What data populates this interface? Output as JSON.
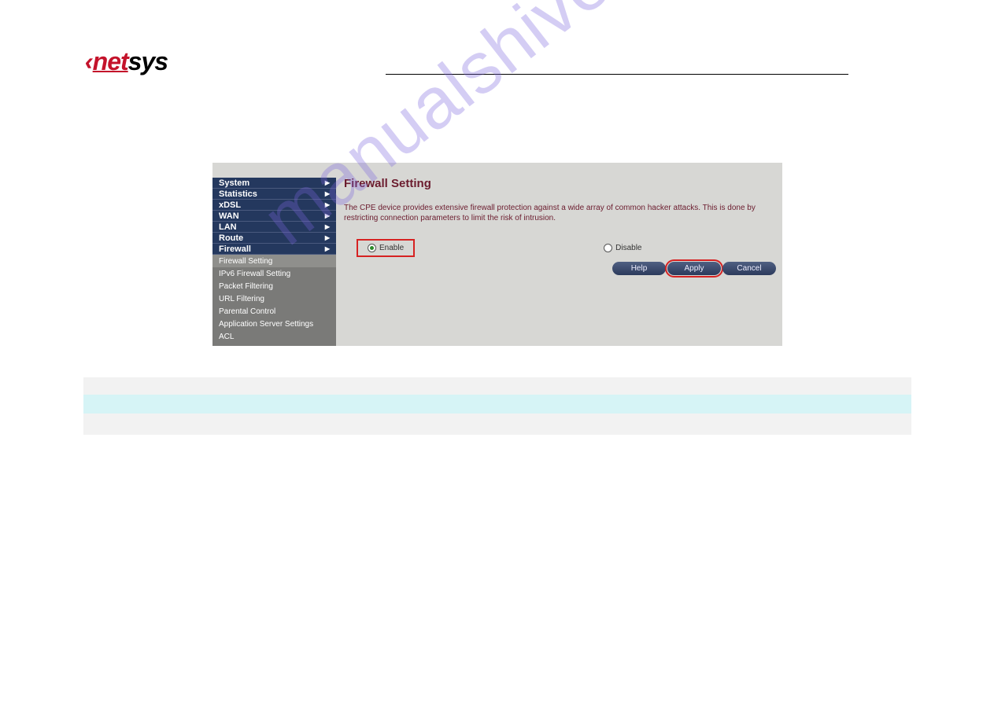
{
  "logo": {
    "prefix": "‹",
    "part1": "net",
    "part2": "sys"
  },
  "watermark": "manualshive.com",
  "nav": {
    "main": [
      {
        "label": "System"
      },
      {
        "label": "Statistics"
      },
      {
        "label": "xDSL"
      },
      {
        "label": "WAN"
      },
      {
        "label": "LAN"
      },
      {
        "label": "Route"
      },
      {
        "label": "Firewall"
      }
    ],
    "sub": [
      {
        "label": "Firewall Setting",
        "active": true
      },
      {
        "label": "IPv6 Firewall Setting",
        "active": false
      },
      {
        "label": "Packet Filtering",
        "active": false
      },
      {
        "label": "URL Filtering",
        "active": false
      },
      {
        "label": "Parental Control",
        "active": false
      },
      {
        "label": "Application Server Settings",
        "active": false
      },
      {
        "label": "ACL",
        "active": false
      }
    ]
  },
  "panel": {
    "title": "Firewall Setting",
    "description": "The CPE device provides extensive firewall protection against a wide array of common hacker attacks. This is done by restricting connection parameters to limit the risk of intrusion.",
    "options": {
      "enable": "Enable",
      "disable": "Disable"
    },
    "buttons": {
      "help": "Help",
      "apply": "Apply",
      "cancel": "Cancel"
    }
  }
}
